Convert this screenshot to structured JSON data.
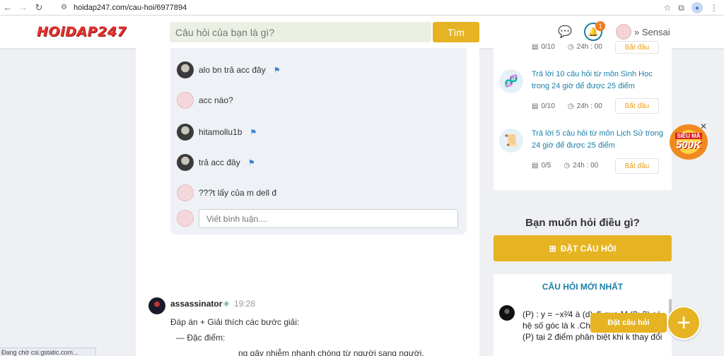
{
  "browser": {
    "url": "hoidap247.com/cau-hoi/6977894",
    "status_text": "Đang chờ csi.gstatic.com..."
  },
  "header": {
    "logo": "HOiDAP247",
    "search_placeholder": "Câu hỏi của bạn là gì?",
    "search_button": "Tìm",
    "notification_count": "1",
    "username": "Sensai"
  },
  "comments": [
    {
      "text": "alo bn trả acc đây",
      "avatar": "dark",
      "flag": true
    },
    {
      "text": "acc nào?",
      "avatar": "pink",
      "flag": false
    },
    {
      "text": "hitamollu1b",
      "avatar": "dark",
      "flag": true
    },
    {
      "text": "trả acc đây",
      "avatar": "dark",
      "flag": true
    },
    {
      "text": "???t lấy của m dell đ",
      "avatar": "pink",
      "flag": false
    }
  ],
  "comment_input_placeholder": "Viết bình luận....",
  "answer": {
    "username": "assassinator",
    "time": "19:28",
    "line1": "Đáp án  +  Giải thích các bước giải:",
    "line2": "— Đặc điểm:",
    "line3": "ng gây nhiễm nhanh chóng từ người sang người."
  },
  "tasks": {
    "top_progress": "0/10",
    "top_time": "24h : 00",
    "items": [
      {
        "text": "Trả lời 10 câu hỏi  từ môn Sinh Học trong 24 giờ để được 25 điểm",
        "progress": "0/10",
        "time": "24h : 00",
        "button": "Bắt đầu"
      },
      {
        "text": "Trả lời 5 câu hỏi  từ môn Lịch Sử trong 24 giờ để được 25 điểm",
        "progress": "0/5",
        "time": "24h : 00",
        "button": "Bắt đầu"
      }
    ],
    "top_button": "Bắt đầu"
  },
  "ask": {
    "title": "Bạn muốn hỏi điều gì?",
    "button": "ĐẶT CÂU HỎI"
  },
  "newest": {
    "title": "CÂU HỎI MỚI NHẤT",
    "text": "(P) : y = −x²⁄4 à (d) đi qua M (0; 2) có hệ số góc là k .Chứng tỏ (d) luôn cắt (P) tại 2 điểm phân biệt khi k thay đổi"
  },
  "promo": {
    "line1": "SIÊU MÃ",
    "line2": "500K"
  },
  "fab_label": "Đặt câu hỏi",
  "colors": {
    "accent": "#e6b422",
    "link": "#1a7fa8",
    "logo": "#e5322d"
  }
}
